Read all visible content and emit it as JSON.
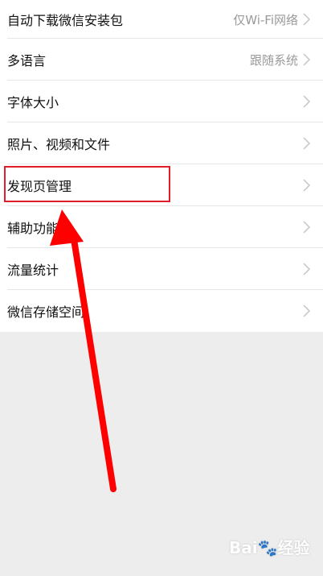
{
  "settings": {
    "items": [
      {
        "label": "自动下载微信安装包",
        "value": "仅Wi-Fi网络"
      },
      {
        "label": "多语言",
        "value": "跟随系统"
      },
      {
        "label": "字体大小",
        "value": ""
      },
      {
        "label": "照片、视频和文件",
        "value": ""
      },
      {
        "label": "发现页管理",
        "value": ""
      },
      {
        "label": "辅助功能",
        "value": ""
      },
      {
        "label": "流量统计",
        "value": ""
      },
      {
        "label": "微信存储空间",
        "value": ""
      }
    ]
  },
  "annotation": {
    "highlight_color": "#e11d2a",
    "arrow_color": "#ff0000"
  },
  "watermark": {
    "text": "Bai🐾经验"
  },
  "icons": {
    "chevron": "chevron-right-icon",
    "arrow": "pointer-arrow"
  }
}
